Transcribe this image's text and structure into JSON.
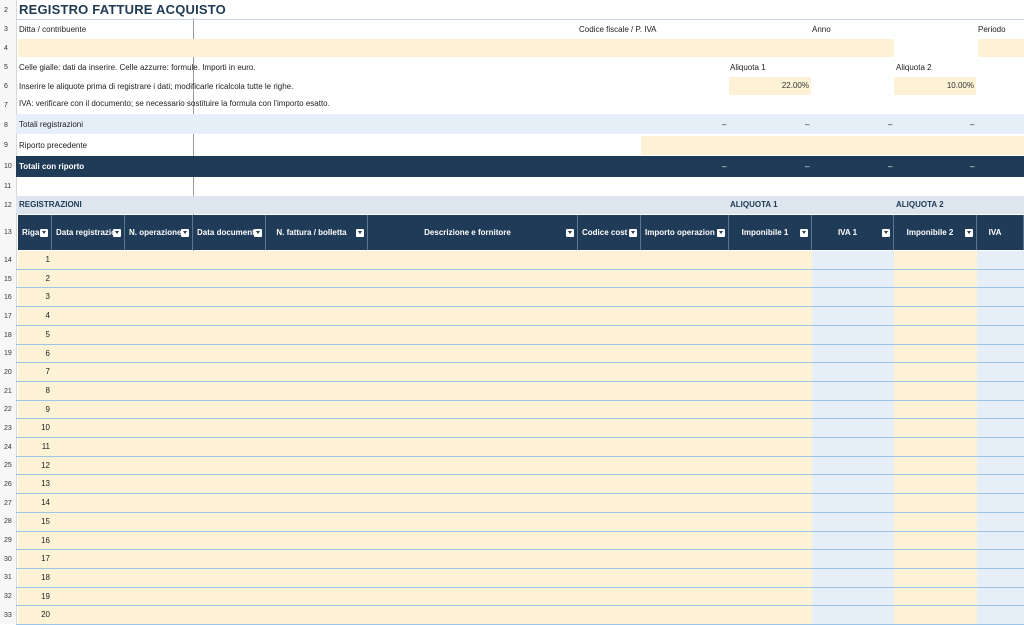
{
  "sheet": {
    "title": "REGISTRO FATTURE ACQUISTO",
    "labels": {
      "ditta": "Ditta / contribuente",
      "codice_fiscale": "Codice fiscale / P. IVA",
      "anno": "Anno",
      "periodo": "Periodo"
    },
    "notes": {
      "note1": "Celle gialle: dati da inserire. Celle azzurre: formule. Importi in euro.",
      "note2": "Inserire le aliquote prima di registrare i dati; modificarle ricalcola tutte le righe.",
      "note3": "IVA: verificare con il documento; se necessario sostituire la formula con l'importo esatto."
    },
    "aliquote": {
      "label1": "Aliquota 1",
      "label2": "Aliquota 2",
      "value1": "22.00%",
      "value2": "10.00%"
    },
    "totals": {
      "totali_registrazioni": "Totali registrazioni",
      "riporto_precedente": "Riporto precedente",
      "totali_con_riporto": "Totali con riporto",
      "dash": "–"
    },
    "section": {
      "registrazioni": "REGISTRAZIONI",
      "aliquota1": "ALIQUOTA 1",
      "aliquota2": "ALIQUOTA 2"
    },
    "columns": [
      "Riga",
      "Data registrazio",
      "N. operazione",
      "Data document",
      "N. fattura / bolletta",
      "Descrizione e fornitore",
      "Codice cost",
      "Importo operazion",
      "Imponibile 1",
      "IVA 1",
      "Imponibile 2",
      "IVA"
    ],
    "row_numbers": [
      "2",
      "3",
      "4",
      "5",
      "6",
      "7",
      "8",
      "9",
      "10",
      "11",
      "12",
      "13",
      "14",
      "15",
      "16",
      "17",
      "18",
      "19",
      "20",
      "21",
      "22",
      "23",
      "24",
      "25",
      "26",
      "27",
      "28",
      "29",
      "30",
      "31",
      "32",
      "33"
    ],
    "rows": [
      "1",
      "2",
      "3",
      "4",
      "5",
      "6",
      "7",
      "8",
      "9",
      "10",
      "11",
      "12",
      "13",
      "14",
      "15",
      "16",
      "17",
      "18",
      "19",
      "20"
    ]
  }
}
